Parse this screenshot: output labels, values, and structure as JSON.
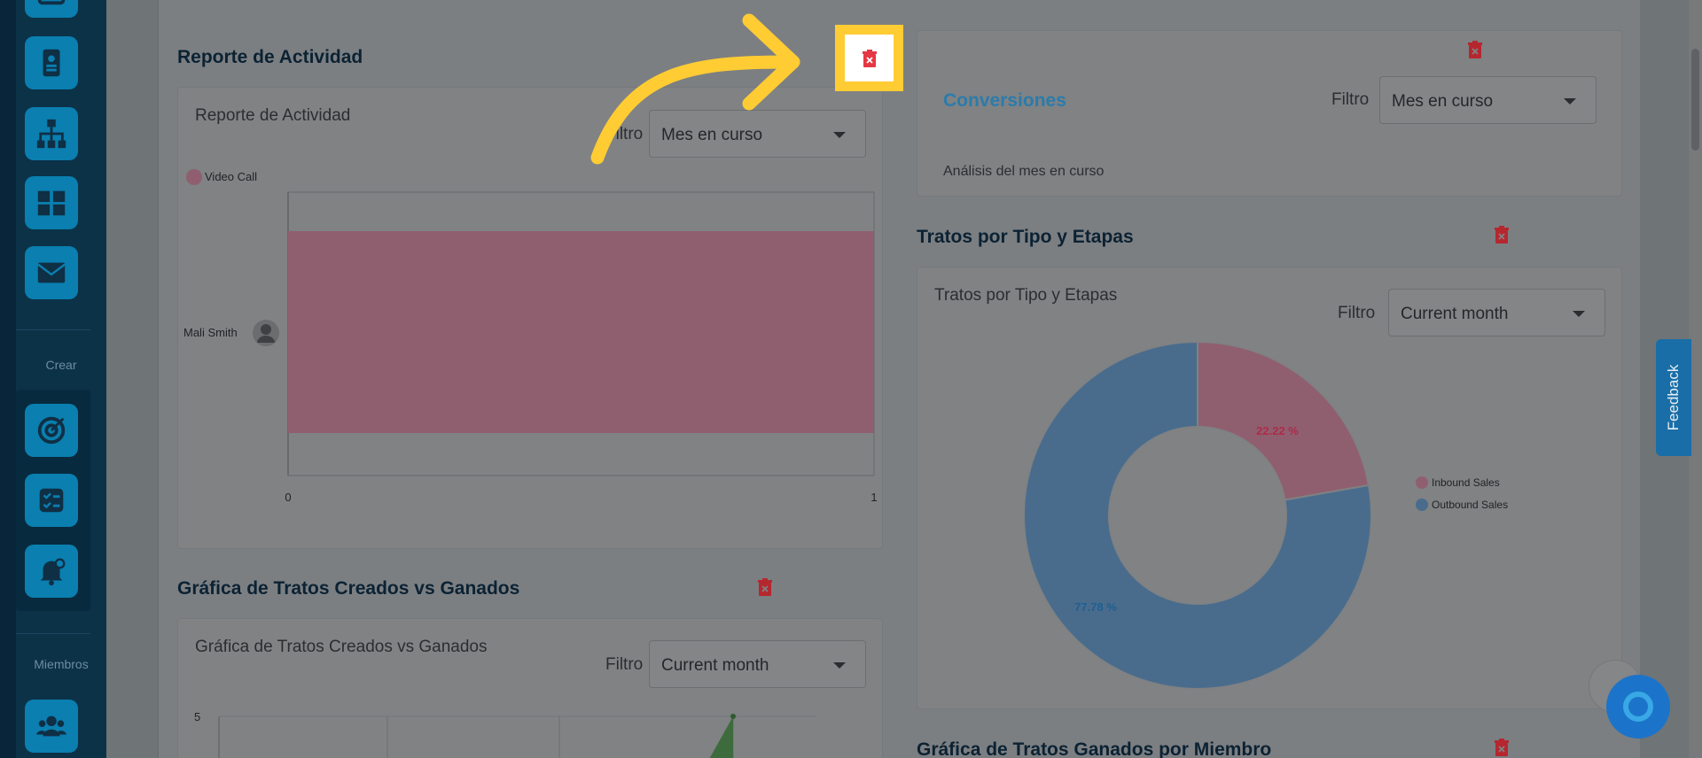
{
  "sidebar": {
    "crear_label": "Crear",
    "miembros_label": "Miembros"
  },
  "activity": {
    "section_title": "Reporte de Actividad",
    "inner_title": "Reporte de Actividad",
    "filter_label": "Filtro",
    "filter_value": "Mes en curso",
    "chart_data": {
      "type": "bar",
      "orientation": "horizontal",
      "categories": [
        "Mali Smith"
      ],
      "series": [
        {
          "name": "Video Call",
          "values": [
            1
          ]
        }
      ],
      "xlim": [
        0,
        1
      ],
      "x_ticks": [
        "0",
        "1"
      ],
      "legend": "top-left",
      "colors": [
        "#8f5f6f"
      ]
    }
  },
  "conversions": {
    "title": "Conversiones",
    "filter_label": "Filtro",
    "filter_value": "Mes en curso",
    "caption": "Análisis del mes en curso"
  },
  "deals_by_type": {
    "section_title": "Tratos por Tipo y Etapas",
    "inner_title": "Tratos por Tipo y Etapas",
    "filter_label": "Filtro",
    "filter_value": "Current month",
    "chart_data": {
      "type": "pie",
      "donut": true,
      "categories": [
        "Inbound Sales",
        "Outbound Sales"
      ],
      "values": [
        22.22,
        77.78
      ],
      "labels": [
        "22.22 %",
        "77.78 %"
      ],
      "colors": [
        "#8f5f6f",
        "#496c8d"
      ],
      "legend": "right"
    }
  },
  "created_vs_won": {
    "section_title": "Gráfica de Tratos Creados vs Ganados",
    "inner_title": "Gráfica de Tratos Creados vs Ganados",
    "filter_label": "Filtro",
    "filter_value": "Current month",
    "chart_data": {
      "type": "area",
      "y_ticks": [
        "5"
      ],
      "color": "#3d6b3d"
    }
  },
  "won_by_member": {
    "section_title": "Gráfica de Tratos Ganados por Miembro"
  },
  "feedback_label": "Feedback",
  "colors": {
    "trash_red": "#c0262f",
    "highlight": "#ffcc33",
    "title_link": "#2b93c9"
  }
}
